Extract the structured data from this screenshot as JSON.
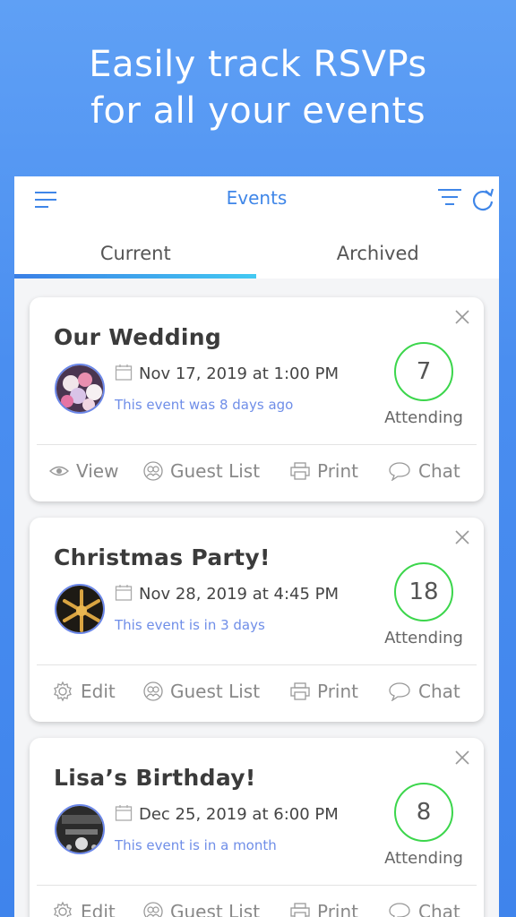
{
  "headline": {
    "line1": "Easily track RSVPs",
    "line2": "for all your events"
  },
  "app": {
    "title": "Events"
  },
  "tabs": [
    {
      "label": "Current"
    },
    {
      "label": "Archived"
    }
  ],
  "events": [
    {
      "title": "Our Wedding",
      "date": "Nov 17, 2019  at  1:00 PM",
      "relative": "This event was 8 days ago",
      "attending_count": "7",
      "attending_label": "Attending",
      "actions": [
        "View",
        "Guest List",
        "Print",
        "Chat"
      ]
    },
    {
      "title": "Christmas Party!",
      "date": "Nov 28, 2019  at  4:45 PM",
      "relative": "This event is in 3 days",
      "attending_count": "18",
      "attending_label": "Attending",
      "actions": [
        "Edit",
        "Guest List",
        "Print",
        "Chat"
      ]
    },
    {
      "title": "Lisa’s Birthday!",
      "date": "Dec 25, 2019  at  6:00 PM",
      "relative": "This event is in a month",
      "attending_count": "8",
      "attending_label": "Attending",
      "actions": [
        "Edit",
        "Guest List",
        "Print",
        "Chat"
      ]
    }
  ],
  "colors": {
    "accent": "#3f86e8",
    "attending_ring": "#3cd64c",
    "relative_text": "#6f8ee8"
  }
}
